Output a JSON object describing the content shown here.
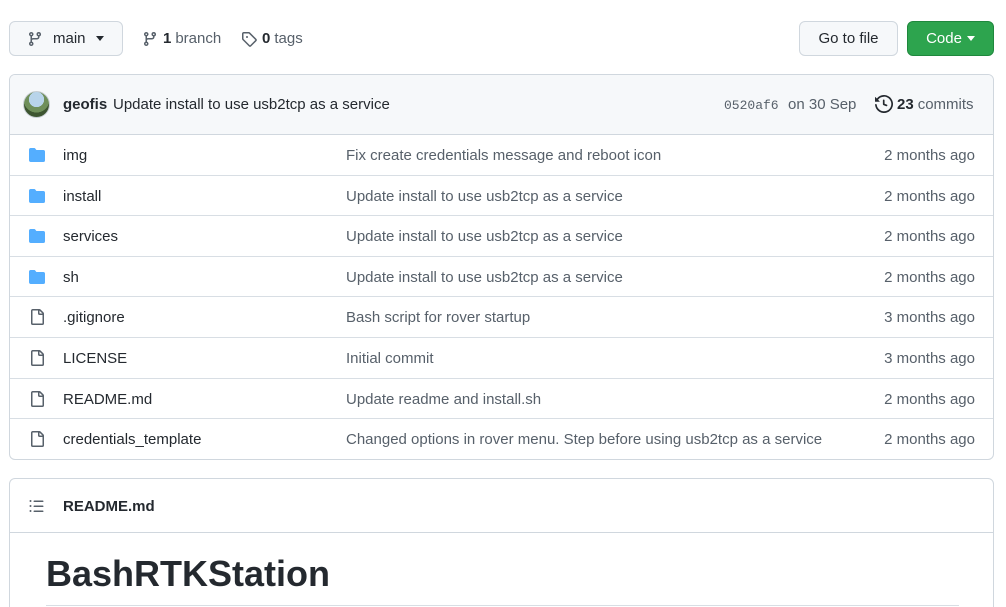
{
  "toolbar": {
    "branch_name": "main",
    "branch_count": "1",
    "branch_label": "branch",
    "tag_count": "0",
    "tag_label": "tags",
    "goto_file_label": "Go to file",
    "code_label": "Code"
  },
  "latest_commit": {
    "author": "geofis",
    "message": "Update install to use usb2tcp as a service",
    "sha": "0520af6",
    "date": "on 30 Sep",
    "commit_count": "23",
    "commits_label": "commits"
  },
  "files": [
    {
      "type": "dir",
      "name": "img",
      "message": "Fix create credentials message and reboot icon",
      "age": "2 months ago"
    },
    {
      "type": "dir",
      "name": "install",
      "message": "Update install to use usb2tcp as a service",
      "age": "2 months ago"
    },
    {
      "type": "dir",
      "name": "services",
      "message": "Update install to use usb2tcp as a service",
      "age": "2 months ago"
    },
    {
      "type": "dir",
      "name": "sh",
      "message": "Update install to use usb2tcp as a service",
      "age": "2 months ago"
    },
    {
      "type": "file",
      "name": ".gitignore",
      "message": "Bash script for rover startup",
      "age": "3 months ago"
    },
    {
      "type": "file",
      "name": "LICENSE",
      "message": "Initial commit",
      "age": "3 months ago"
    },
    {
      "type": "file",
      "name": "README.md",
      "message": "Update readme and install.sh",
      "age": "2 months ago"
    },
    {
      "type": "file",
      "name": "credentials_template",
      "message": "Changed options in rover menu. Step before using usb2tcp as a service",
      "age": "2 months ago"
    }
  ],
  "readme": {
    "filename": "README.md",
    "heading": "BashRTKStation"
  },
  "colors": {
    "folder": "#54aeff",
    "code_button": "#2da44e"
  }
}
